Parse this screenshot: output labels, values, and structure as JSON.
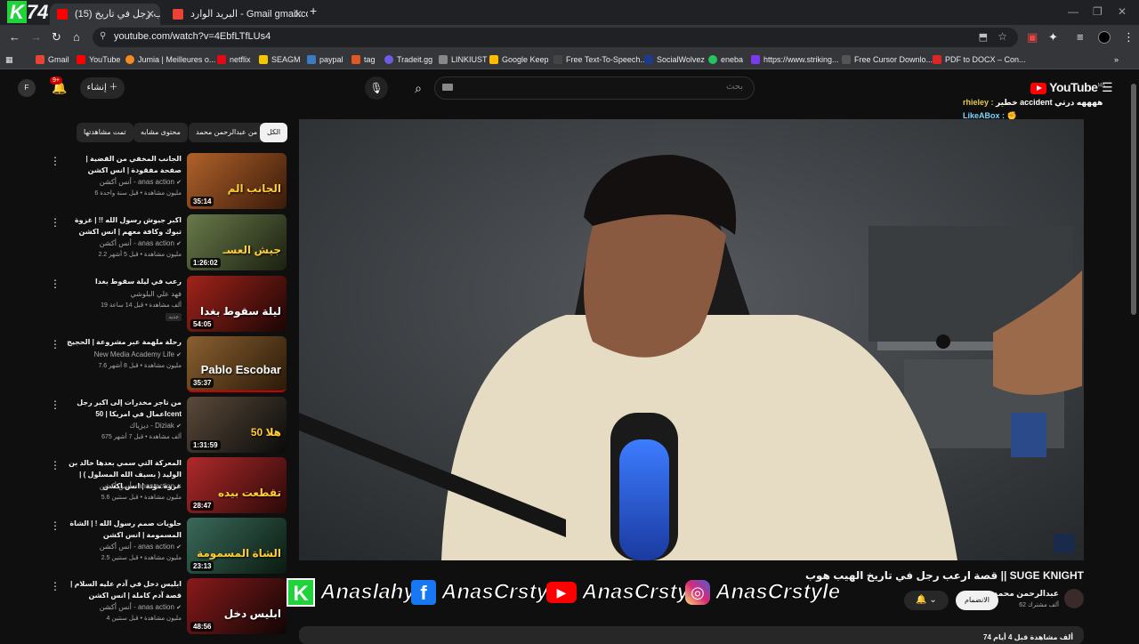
{
  "browser": {
    "overlay_logo": "74",
    "tabs": [
      {
        "title": "(15) قصة ارعب رجل في تاريخ",
        "active": true
      },
      {
        "title": "البريد الوارد - Gmail gmail.com",
        "active": false
      }
    ],
    "new_tab": "+",
    "url": "youtube.com/watch?v=4EbfLTfLUs4",
    "bookmarks": [
      {
        "label": "Gmail",
        "color": "#ea4335"
      },
      {
        "label": "YouTube",
        "color": "#ff0000"
      },
      {
        "label": "Jumia | Meilleures o...",
        "color": "#f68b1e"
      },
      {
        "label": "netflix",
        "color": "#e50914"
      },
      {
        "label": "SEAGM",
        "color": "#f7c600"
      },
      {
        "label": "paypal",
        "color": "#3b7bbf"
      },
      {
        "label": "tag",
        "color": "#e25822"
      },
      {
        "label": "Tradeit.gg",
        "color": "#6c5ce7"
      },
      {
        "label": "LINKIUST",
        "color": "#888888"
      },
      {
        "label": "Google Keep",
        "color": "#fbbc04"
      },
      {
        "label": "Free Text-To-Speech...",
        "color": "#444444"
      },
      {
        "label": "SocialWolvez",
        "color": "#1e3a8a"
      },
      {
        "label": "eneba",
        "color": "#22c55e"
      },
      {
        "label": "https://www.striking...",
        "color": "#7c3aed"
      },
      {
        "label": "Free Cursor Downlo...",
        "color": "#555555"
      },
      {
        "label": "PDF to DOCX – Con...",
        "color": "#dc2626"
      }
    ]
  },
  "header": {
    "logo": "YouTube",
    "logo_region": "MA",
    "search_placeholder": "بحث",
    "create_label": "إنشاء",
    "notif_count": "9+",
    "avatar_letter": "F"
  },
  "chat": [
    {
      "user": "rhieley :",
      "text": "خطير accident ههههه درتي"
    },
    {
      "user": "LikeABox :",
      "text": "✊"
    }
  ],
  "chips": [
    "الكل",
    "من عبدالرحمن محمد",
    "محتوى مشابه",
    "تمت مشاهدتها"
  ],
  "recommendations": [
    {
      "title": "الجانب المخفي من القضية | صفحة مفقودة | انس اكشن",
      "channel": "أنس أكشن - anas action",
      "stats": "6 مليون مشاهدة • قبل سنة واحدة",
      "duration": "35:14",
      "thumb_text": "الجانب الم",
      "bg": "#7a3b1f",
      "new": ""
    },
    {
      "title": "اكبر جيوش رسول الله !! | غزوة تبوك وكافة معهم | انس اكشن",
      "channel": "أنس أكشن - anas action",
      "stats": "2.2 مليون مشاهدة • قبل 5 أشهر",
      "duration": "1:26:02",
      "thumb_text": "جيش العسـ",
      "bg": "#3d4a2a",
      "new": ""
    },
    {
      "title": "رعب في ليلة سقوط بغدا",
      "channel": "فهد علي البلوشي",
      "stats": "19 ألف مشاهدة • قبل 14 ساعة",
      "duration": "54:05",
      "thumb_text": "ليلة سقوط بغدا",
      "bg": "#6b1510",
      "new": "جديد"
    },
    {
      "title": "رحلة ملهمة عبر مشروعة | الحجيج",
      "channel": "New Media Academy Life",
      "stats": "7.6 مليون مشاهدة • قبل 8 أشهر",
      "duration": "35:37",
      "thumb_text": "Pablo Escobar",
      "bg": "#5a3a18",
      "new": ""
    },
    {
      "title": "من تاجر مخدرات إلى اكبر رجل اعمال في امريكا | 50cent",
      "channel": "ديزياك - Diziak",
      "stats": "675 ألف مشاهدة • قبل 7 أشهر",
      "duration": "1:31:59",
      "thumb_text": "50 هلا",
      "bg": "#3a2a1a",
      "new": ""
    },
    {
      "title": "المعركة التي سمي بعدها خالد بن الوليد ( بسيف الله المسلول ) | غزوة مؤتة | انس اكشن",
      "channel": "أنس أكشن - anas action",
      "stats": "5.6 مليون مشاهدة • قبل سنتين",
      "duration": "28:47",
      "thumb_text": "تقطعت بيده",
      "bg": "#7a1a1a",
      "new": ""
    },
    {
      "title": "حلويات صمم رسول الله ! | الشاة المسمومة | انس اكشن",
      "channel": "أنس أكشن - anas action",
      "stats": "2.5 مليون مشاهدة • قبل سنتين",
      "duration": "23:13",
      "thumb_text": "الشاة المسمومة",
      "bg": "#2a4a3a",
      "new": ""
    },
    {
      "title": "ابليس دخل في آدم عليه السلام | قصة آدم كاملة | انس اكشن",
      "channel": "أنس أكشن - anas action",
      "stats": "4 مليون مشاهدة • قبل سنتين",
      "duration": "48:56",
      "thumb_text": "ابليس دخل",
      "bg": "#4a1a1a",
      "new": ""
    }
  ],
  "video": {
    "title": "قصة ارعب رجل في تاريخ الهيب هوب || SUGE KNIGHT",
    "channel": "عبدالرحمن محمد",
    "subs": "62 ألف مشترك",
    "join_label": "الانضمام",
    "views_hint": "74 ألف مشاهدة قبل 4 أيام"
  },
  "social": [
    {
      "icon": "K",
      "label": "Anaslahya",
      "color": "#1fd43a"
    },
    {
      "icon": "f",
      "label": "AnasCrstyle",
      "color": "#1877f2"
    },
    {
      "icon": "▶",
      "label": "AnasCrstyle",
      "color": "#ff0000"
    },
    {
      "icon": "◎",
      "label": "AnasCrstyle",
      "color": "#d62976"
    }
  ]
}
